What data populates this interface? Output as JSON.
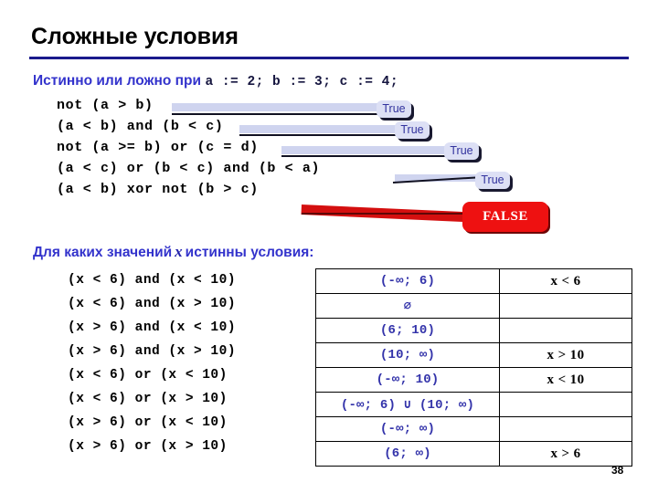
{
  "slide": {
    "title": "Сложные условия",
    "page_number": "38",
    "accent_color": "#3333cc",
    "rule_color": "#1a1a8c",
    "true_badge_bg": "#dde0f5",
    "true_badge_fg": "#33339e",
    "false_badge_bg": "#ee1111",
    "false_badge_fg": "#ffffff"
  },
  "section1": {
    "prompt_text": "Истинно или ложно при",
    "prompt_code": "a := 2;  b := 3;  c := 4;",
    "expressions": [
      {
        "code": "not (a > b)",
        "result": "True"
      },
      {
        "code": "(a < b) and (b < c)",
        "result": "True"
      },
      {
        "code": "not (a >= b) or (c = d)",
        "result": "True"
      },
      {
        "code": "(a < c) or (b < c) and (b < a)",
        "result": "True"
      },
      {
        "code": "(a < b) xor not (b > c)",
        "result": "FALSE"
      }
    ]
  },
  "section2": {
    "prompt_before": "Для каких значений",
    "variable": "x",
    "prompt_after": "истинны условия:",
    "rows": [
      {
        "condition": "(x < 6) and (x < 10)",
        "interval": "(-∞; 6)",
        "answer": "x < 6"
      },
      {
        "condition": "(x < 6) and (x > 10)",
        "interval": "∅",
        "answer": ""
      },
      {
        "condition": "(x > 6) and (x < 10)",
        "interval": "(6; 10)",
        "answer": ""
      },
      {
        "condition": "(x > 6) and (x > 10)",
        "interval": "(10; ∞)",
        "answer": "x > 10"
      },
      {
        "condition": "(x < 6) or (x < 10)",
        "interval": "(-∞; 10)",
        "answer": "x < 10"
      },
      {
        "condition": "(x < 6) or (x > 10)",
        "interval": "(-∞; 6) ∪ (10; ∞)",
        "answer": ""
      },
      {
        "condition": "(x > 6) or (x < 10)",
        "interval": "(-∞; ∞)",
        "answer": ""
      },
      {
        "condition": "(x > 6) or (x > 10)",
        "interval": "(6; ∞)",
        "answer": "x > 6"
      }
    ]
  }
}
